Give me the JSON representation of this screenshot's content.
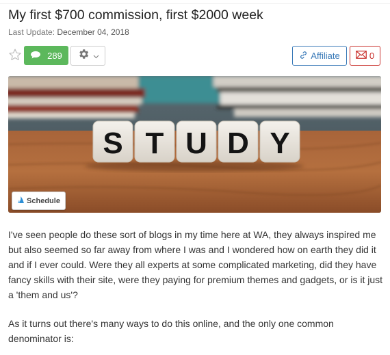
{
  "post": {
    "title": "My first $700 commission, first $2000 week",
    "last_update_label": "Last Update:",
    "last_update_date": "December 04, 2018"
  },
  "toolbar": {
    "comment_count": "289",
    "affiliate_label": "Affiliate",
    "message_count": "0"
  },
  "hero": {
    "letters": [
      "S",
      "T",
      "U",
      "D",
      "Y"
    ],
    "schedule_label": "Schedule"
  },
  "body": {
    "paragraph_1": "I've seen people do these sort of blogs in my time here at WA, they always inspired me but also seemed so far away from where I was and I wondered how on earth they did it and if I ever could. Were they all experts at some complicated marketing, did they have fancy skills with their site, were they paying for premium themes and gadgets, or is it just a 'them and us'?",
    "paragraph_2": "As it turns out there's many ways to do this online, and the only one common denominator is:"
  },
  "colors": {
    "comments_green": "#5cb85c",
    "affiliate_blue": "#3a7ab8",
    "mail_red": "#c9302c"
  },
  "icons": [
    "star-icon",
    "comment-bubble-icon",
    "gear-icon",
    "chevron-down-icon",
    "link-icon",
    "envelope-icon",
    "schedule-logo-icon"
  ]
}
